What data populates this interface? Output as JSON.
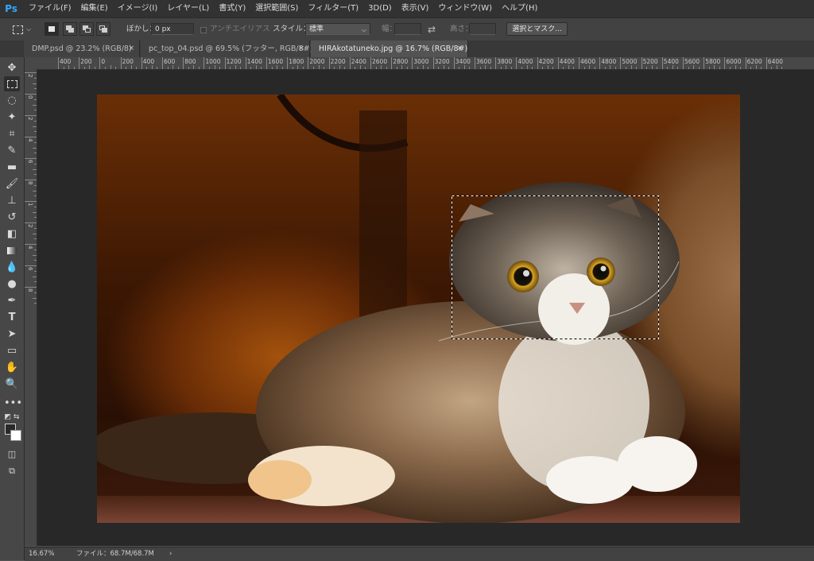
{
  "app": {
    "logo": "Ps"
  },
  "menu": [
    "ファイル(F)",
    "編集(E)",
    "イメージ(I)",
    "レイヤー(L)",
    "書式(Y)",
    "選択範囲(S)",
    "フィルター(T)",
    "3D(D)",
    "表示(V)",
    "ウィンドウ(W)",
    "ヘルプ(H)"
  ],
  "options": {
    "feather_label": "ぼかし：",
    "feather_value": "0 px",
    "antialias_label": "アンチエイリアス",
    "style_label": "スタイル：",
    "style_value": "標準",
    "width_label": "幅：",
    "height_label": "高さ：",
    "select_mask_button": "選択とマスク..."
  },
  "tabs": [
    {
      "label": "DMP.psd @ 23.2% (RGB/8)",
      "close": "×"
    },
    {
      "label": "pc_top_04.psd @ 69.5% (フッター, RGB/8#)",
      "close": "×"
    },
    {
      "label": "HIRAkotatuneko.jpg @ 16.7% (RGB/8#)",
      "close": "×"
    }
  ],
  "ruler": {
    "horizontal": [
      "400",
      "200",
      "0",
      "200",
      "400",
      "600",
      "800",
      "1000",
      "1200",
      "1400",
      "1600",
      "1800",
      "2000",
      "2200",
      "2400",
      "2600",
      "2800",
      "3000",
      "3200",
      "3400",
      "3600",
      "3800",
      "4000",
      "4200",
      "4400",
      "4600",
      "4800",
      "5000",
      "5200",
      "5400",
      "5600",
      "5800",
      "6000",
      "6200",
      "6400"
    ],
    "vertical": [
      "2",
      "0",
      "2",
      "4",
      "6",
      "8",
      "1",
      "2",
      "4",
      "6",
      "8"
    ]
  },
  "tools": [
    "move-tool",
    "marquee-tool",
    "lasso-tool",
    "quick-select-tool",
    "crop-tool",
    "eyedropper-tool",
    "healing-brush-tool",
    "brush-tool",
    "clone-stamp-tool",
    "history-brush-tool",
    "eraser-tool",
    "gradient-tool",
    "blur-tool",
    "dodge-tool",
    "pen-tool",
    "type-tool",
    "path-select-tool",
    "rectangle-tool",
    "hand-tool",
    "zoom-tool",
    "more-tools",
    "default-colors",
    "foreground-background-color",
    "quick-mask",
    "screen-mode"
  ],
  "status": {
    "zoom": "16.67%",
    "file_info": "ファイル：68.7M/68.7M",
    "arrow": "›"
  }
}
